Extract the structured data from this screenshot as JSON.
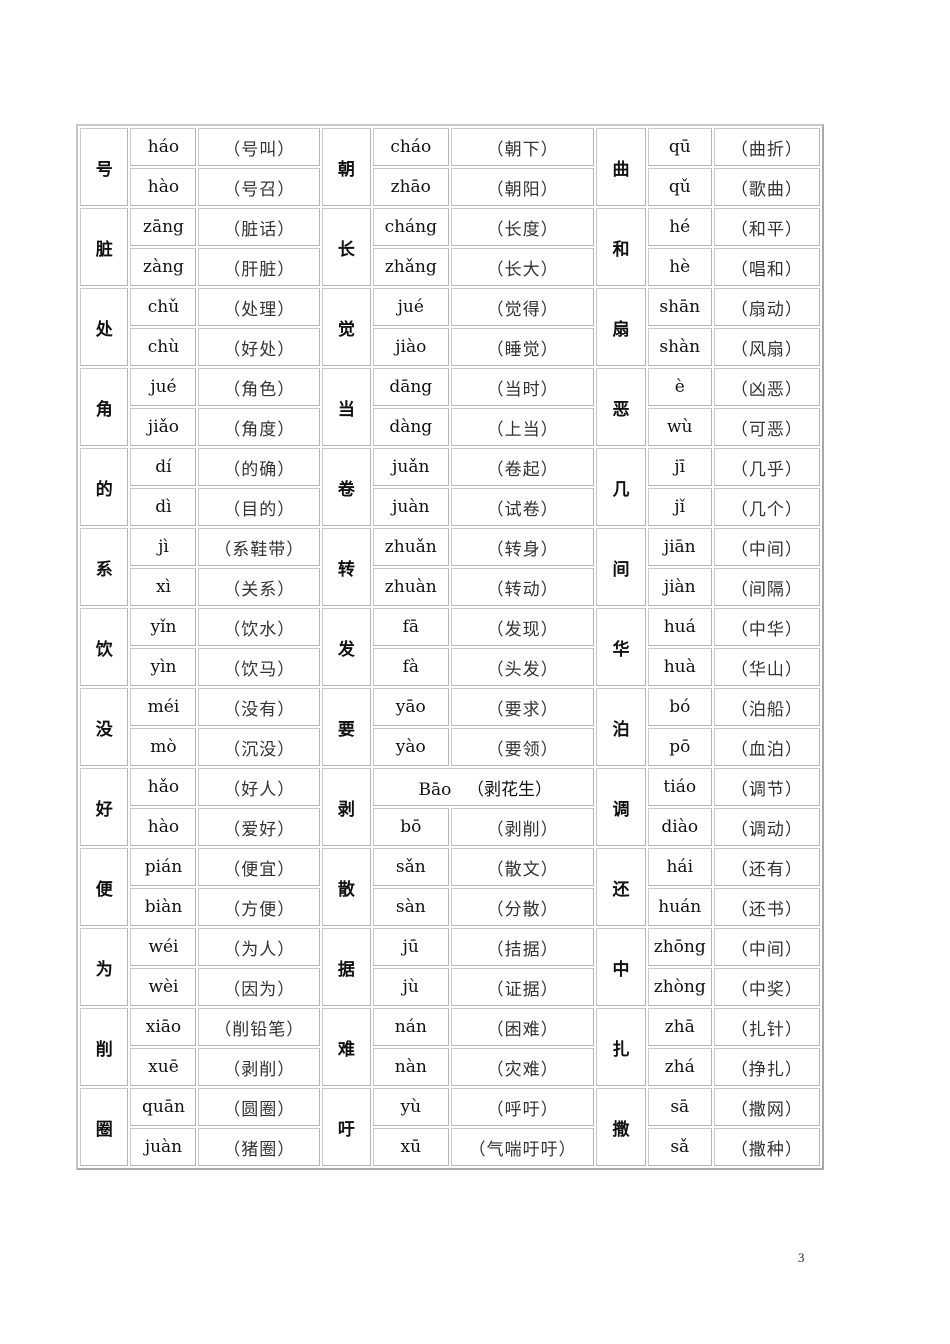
{
  "page_number": "3",
  "rows": [
    [
      {
        "char": "号",
        "readings": [
          {
            "pinyin": "háo",
            "word": "（号叫）"
          },
          {
            "pinyin": "hào",
            "word": "（号召）"
          }
        ]
      },
      {
        "char": "朝",
        "readings": [
          {
            "pinyin": "cháo",
            "word": "（朝下）"
          },
          {
            "pinyin": "zhāo",
            "word": "（朝阳）"
          }
        ]
      },
      {
        "char": "曲",
        "readings": [
          {
            "pinyin": "qū",
            "word": "（曲折）"
          },
          {
            "pinyin": "qǔ",
            "word": "（歌曲）"
          }
        ]
      }
    ],
    [
      {
        "char": "脏",
        "readings": [
          {
            "pinyin": "zāng",
            "word": "（脏话）"
          },
          {
            "pinyin": "zàng",
            "word": "（肝脏）"
          }
        ]
      },
      {
        "char": "长",
        "readings": [
          {
            "pinyin": "cháng",
            "word": "（长度）"
          },
          {
            "pinyin": "zhǎng",
            "word": "（长大）"
          }
        ]
      },
      {
        "char": "和",
        "readings": [
          {
            "pinyin": "hé",
            "word": "（和平）"
          },
          {
            "pinyin": "hè",
            "word": "（唱和）"
          }
        ]
      }
    ],
    [
      {
        "char": "处",
        "readings": [
          {
            "pinyin": "chǔ",
            "word": "（处理）"
          },
          {
            "pinyin": "chù",
            "word": "（好处）"
          }
        ]
      },
      {
        "char": "觉",
        "readings": [
          {
            "pinyin": "jué",
            "word": "（觉得）"
          },
          {
            "pinyin": "jiào",
            "word": "（睡觉）"
          }
        ]
      },
      {
        "char": "扇",
        "readings": [
          {
            "pinyin": "shān",
            "word": "（扇动）"
          },
          {
            "pinyin": "shàn",
            "word": "（风扇）"
          }
        ]
      }
    ],
    [
      {
        "char": "角",
        "readings": [
          {
            "pinyin": "jué",
            "word": "（角色）"
          },
          {
            "pinyin": "jiǎo",
            "word": "（角度）"
          }
        ]
      },
      {
        "char": "当",
        "readings": [
          {
            "pinyin": "dāng",
            "word": "（当时）"
          },
          {
            "pinyin": "dàng",
            "word": "（上当）"
          }
        ]
      },
      {
        "char": "恶",
        "readings": [
          {
            "pinyin": "è",
            "word": "（凶恶）"
          },
          {
            "pinyin": "wù",
            "word": "（可恶）"
          }
        ]
      }
    ],
    [
      {
        "char": "的",
        "readings": [
          {
            "pinyin": "dí",
            "word": "（的确）"
          },
          {
            "pinyin": "dì",
            "word": "（目的）"
          }
        ]
      },
      {
        "char": "卷",
        "readings": [
          {
            "pinyin": "juǎn",
            "word": "（卷起）"
          },
          {
            "pinyin": "juàn",
            "word": "（试卷）"
          }
        ]
      },
      {
        "char": "几",
        "readings": [
          {
            "pinyin": "jī",
            "word": "（几乎）"
          },
          {
            "pinyin": "jǐ",
            "word": "（几个）"
          }
        ]
      }
    ],
    [
      {
        "char": "系",
        "readings": [
          {
            "pinyin": "jì",
            "word": "（系鞋带）"
          },
          {
            "pinyin": "xì",
            "word": "（关系）"
          }
        ]
      },
      {
        "char": "转",
        "readings": [
          {
            "pinyin": "zhuǎn",
            "word": "（转身）"
          },
          {
            "pinyin": "zhuàn",
            "word": "（转动）"
          }
        ]
      },
      {
        "char": "间",
        "readings": [
          {
            "pinyin": "jiān",
            "word": "（中间）"
          },
          {
            "pinyin": "jiàn",
            "word": "（间隔）"
          }
        ]
      }
    ],
    [
      {
        "char": "饮",
        "readings": [
          {
            "pinyin": "yǐn",
            "word": "（饮水）"
          },
          {
            "pinyin": "yìn",
            "word": "（饮马）"
          }
        ]
      },
      {
        "char": "发",
        "readings": [
          {
            "pinyin": "fā",
            "word": "（发现）"
          },
          {
            "pinyin": "fà",
            "word": "（头发）"
          }
        ]
      },
      {
        "char": "华",
        "readings": [
          {
            "pinyin": "huá",
            "word": "（中华）"
          },
          {
            "pinyin": "huà",
            "word": "（华山）"
          }
        ]
      }
    ],
    [
      {
        "char": "没",
        "readings": [
          {
            "pinyin": "méi",
            "word": "（没有）"
          },
          {
            "pinyin": "mò",
            "word": "（沉没）"
          }
        ]
      },
      {
        "char": "要",
        "readings": [
          {
            "pinyin": "yāo",
            "word": "（要求）"
          },
          {
            "pinyin": "yào",
            "word": "（要领）"
          }
        ]
      },
      {
        "char": "泊",
        "readings": [
          {
            "pinyin": "bó",
            "word": "（泊船）"
          },
          {
            "pinyin": "pō",
            "word": "（血泊）"
          }
        ]
      }
    ],
    [
      {
        "char": "好",
        "readings": [
          {
            "pinyin": "hǎo",
            "word": "（好人）"
          },
          {
            "pinyin": "hào",
            "word": "（爱好）"
          }
        ]
      },
      {
        "char": "剥",
        "readings": [
          {
            "pinyin": "Bāo",
            "word": "（剥花生）",
            "merged": true
          },
          {
            "pinyin": "bō",
            "word": "（剥削）"
          }
        ]
      },
      {
        "char": "调",
        "readings": [
          {
            "pinyin": "tiáo",
            "word": "（调节）"
          },
          {
            "pinyin": "diào",
            "word": "（调动）"
          }
        ]
      }
    ],
    [
      {
        "char": "便",
        "readings": [
          {
            "pinyin": "pián",
            "word": "（便宜）"
          },
          {
            "pinyin": "biàn",
            "word": "（方便）"
          }
        ]
      },
      {
        "char": "散",
        "readings": [
          {
            "pinyin": "sǎn",
            "word": "（散文）"
          },
          {
            "pinyin": "sàn",
            "word": "（分散）"
          }
        ]
      },
      {
        "char": "还",
        "readings": [
          {
            "pinyin": "hái",
            "word": "（还有）"
          },
          {
            "pinyin": "huán",
            "word": "（还书）"
          }
        ]
      }
    ],
    [
      {
        "char": "为",
        "readings": [
          {
            "pinyin": "wéi",
            "word": "（为人）"
          },
          {
            "pinyin": "wèi",
            "word": "（因为）"
          }
        ]
      },
      {
        "char": "据",
        "readings": [
          {
            "pinyin": "jū",
            "word": "（拮据）"
          },
          {
            "pinyin": "jù",
            "word": "（证据）"
          }
        ]
      },
      {
        "char": "中",
        "readings": [
          {
            "pinyin": "zhōng",
            "word": "（中间）"
          },
          {
            "pinyin": "zhòng",
            "word": "（中奖）"
          }
        ]
      }
    ],
    [
      {
        "char": "削",
        "readings": [
          {
            "pinyin": "xiāo",
            "word": "（削铅笔）"
          },
          {
            "pinyin": "xuē",
            "word": "（剥削）"
          }
        ]
      },
      {
        "char": "难",
        "readings": [
          {
            "pinyin": "nán",
            "word": "（困难）"
          },
          {
            "pinyin": "nàn",
            "word": "（灾难）"
          }
        ]
      },
      {
        "char": "扎",
        "readings": [
          {
            "pinyin": "zhā",
            "word": "（扎针）"
          },
          {
            "pinyin": "zhá",
            "word": "（挣扎）"
          }
        ]
      }
    ],
    [
      {
        "char": "圈",
        "readings": [
          {
            "pinyin": "quān",
            "word": "（圆圈）"
          },
          {
            "pinyin": "juàn",
            "word": "（猪圈）"
          }
        ]
      },
      {
        "char": "吁",
        "readings": [
          {
            "pinyin": "yù",
            "word": "（呼吁）"
          },
          {
            "pinyin": "xū",
            "word": "（气喘吁吁）"
          }
        ]
      },
      {
        "char": "撒",
        "readings": [
          {
            "pinyin": "sā",
            "word": "（撒网）"
          },
          {
            "pinyin": "sǎ",
            "word": "（撒种）"
          }
        ]
      }
    ]
  ]
}
